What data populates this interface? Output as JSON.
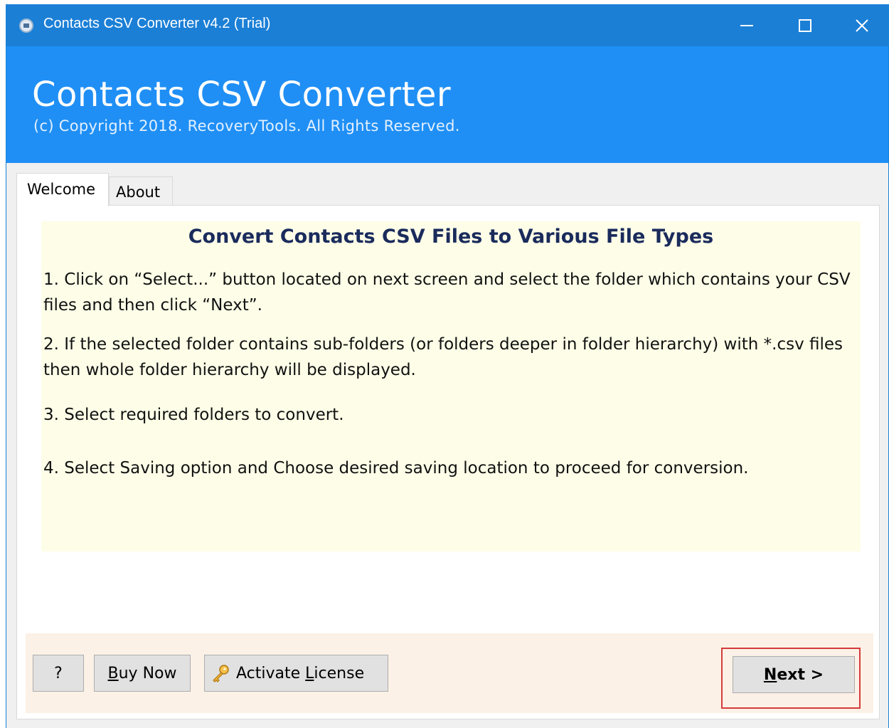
{
  "window": {
    "title": "Contacts CSV Converter v4.2 (Trial)",
    "minimize": "—",
    "maximize": "☐",
    "close": "✕"
  },
  "header": {
    "app_name": "Contacts CSV Converter",
    "copyright": "(c) Copyright 2018. RecoveryTools. All Rights Reserved."
  },
  "tabs": [
    {
      "label": "Welcome",
      "active": true
    },
    {
      "label": "About",
      "active": false
    }
  ],
  "instructions": {
    "heading": "Convert Contacts CSV Files to Various File Types",
    "steps": [
      "1. Click on “Select...” button located on next screen and select the folder which contains your CSV files and then click “Next”.",
      "2. If the selected folder contains sub-folders (or folders deeper in folder hierarchy) with *.csv files then whole folder hierarchy will be displayed.",
      "3. Select required folders to convert.",
      "4. Select Saving option and Choose desired saving location to proceed for conversion."
    ]
  },
  "footer": {
    "help_label": "?",
    "buy_now_mnemonic": "B",
    "buy_now_rest": "uy Now",
    "activate_prefix": "Activate ",
    "activate_mnemonic": "L",
    "activate_rest": "icense",
    "next_mnemonic": "N",
    "next_rest": "ext >"
  },
  "colors": {
    "titlebar": "#1b7fd6",
    "header": "#1f8ff5",
    "instructions_bg": "#fefee8",
    "footer_bg": "#fcf1e6",
    "next_highlight": "#d43b3b"
  }
}
